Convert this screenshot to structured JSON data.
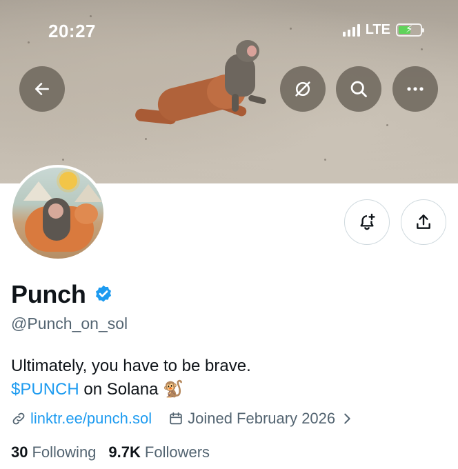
{
  "status_bar": {
    "time": "20:27",
    "network": "LTE",
    "icons": [
      "signal-icon",
      "battery-charging-icon"
    ]
  },
  "header_buttons": {
    "back_icon": "back-arrow-icon",
    "grok_icon": "grok-icon",
    "search_icon": "search-icon",
    "more_icon": "more-icon"
  },
  "profile": {
    "name": "Punch",
    "verified": true,
    "handle": "@Punch_on_sol",
    "bio_line1": "Ultimately, you have to be brave.",
    "bio_ticker": "$PUNCH",
    "bio_rest": " on Solana ",
    "bio_emoji": "🐒",
    "link": "linktr.ee/punch.sol",
    "joined": "Joined February 2026",
    "following_count": "30",
    "following_label": "Following",
    "followers_count": "9.7K",
    "followers_label": "Followers"
  },
  "actions": {
    "notify_icon": "bell-plus-icon",
    "share_icon": "share-icon"
  },
  "colors": {
    "accent": "#1d9bf0",
    "text": "#0f1419",
    "secondary": "#536471",
    "verified": "#1d9bf0"
  }
}
